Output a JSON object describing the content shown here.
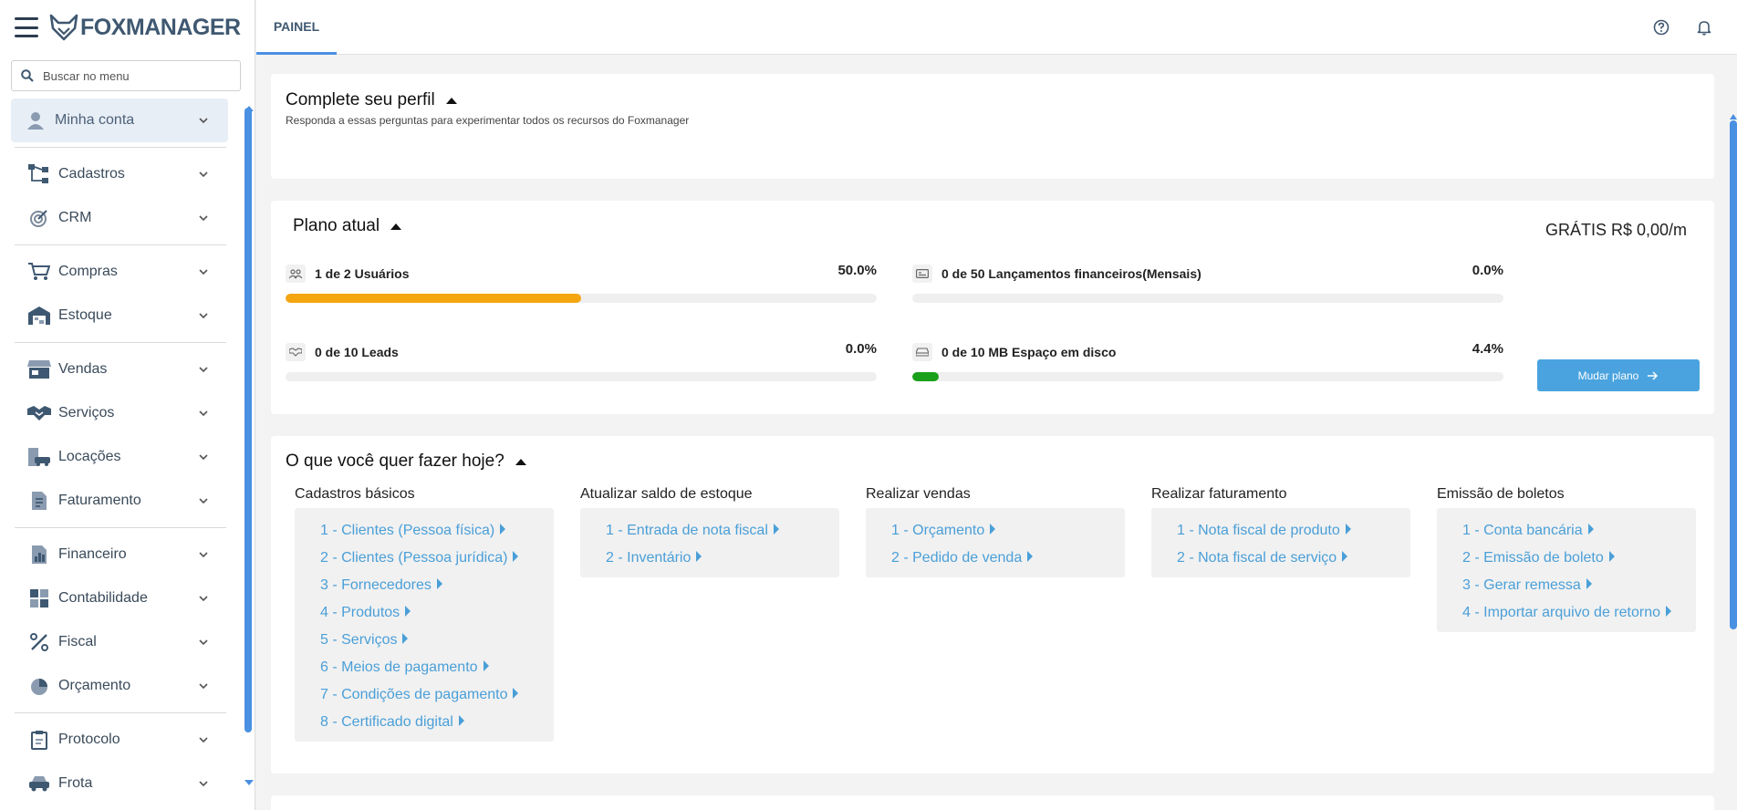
{
  "app": {
    "brand": "FOXMANAGER"
  },
  "search": {
    "placeholder": "Buscar no menu"
  },
  "sidebar": {
    "items": [
      {
        "label": "Minha conta",
        "icon": "user-icon"
      },
      {
        "label": "Cadastros",
        "icon": "sitemap-icon"
      },
      {
        "label": "CRM",
        "icon": "target-icon"
      },
      {
        "label": "Compras",
        "icon": "cart-icon"
      },
      {
        "label": "Estoque",
        "icon": "warehouse-icon"
      },
      {
        "label": "Vendas",
        "icon": "store-icon"
      },
      {
        "label": "Serviços",
        "icon": "handshake-icon"
      },
      {
        "label": "Locações",
        "icon": "building-car-icon"
      },
      {
        "label": "Faturamento",
        "icon": "invoice-icon"
      },
      {
        "label": "Financeiro",
        "icon": "chart-file-icon"
      },
      {
        "label": "Contabilidade",
        "icon": "calculator-icon"
      },
      {
        "label": "Fiscal",
        "icon": "percent-icon"
      },
      {
        "label": "Orçamento",
        "icon": "pie-chart-icon"
      },
      {
        "label": "Protocolo",
        "icon": "clipboard-icon"
      },
      {
        "label": "Frota",
        "icon": "car-icon"
      }
    ]
  },
  "header": {
    "tab": "PAINEL"
  },
  "profile": {
    "title": "Complete seu perfil",
    "subtitle": "Responda a essas perguntas para experimentar todos os recursos do Foxmanager"
  },
  "plan": {
    "title": "Plano atual",
    "price": "GRÁTIS R$ 0,00/m",
    "button": "Mudar plano",
    "usage": [
      {
        "label": "1 de 2 Usuários",
        "percent": "50.0%",
        "fill": 50.0,
        "color": "#f5a510",
        "icon": "users-icon"
      },
      {
        "label": "0 de 50 Lançamentos financeiros(Mensais)",
        "percent": "0.0%",
        "fill": 0.0,
        "color": "#f5a510",
        "icon": "money-icon"
      },
      {
        "label": "0 de 10 Leads",
        "percent": "0.0%",
        "fill": 0.0,
        "color": "#f5a510",
        "icon": "handshake-icon"
      },
      {
        "label": "0 de 10 MB Espaço em disco",
        "percent": "4.4%",
        "fill": 4.4,
        "color": "#1aa01a",
        "icon": "disk-icon"
      }
    ]
  },
  "todo": {
    "title": "O que você quer fazer hoje?",
    "columns": [
      {
        "title": "Cadastros básicos",
        "links": [
          "1 - Clientes (Pessoa física)",
          "2 - Clientes (Pessoa jurídica)",
          "3 - Fornecedores",
          "4 - Produtos",
          "5 - Serviços",
          "6 - Meios de pagamento",
          "7 - Condições de pagamento",
          "8 - Certificado digital"
        ]
      },
      {
        "title": "Atualizar saldo de estoque",
        "links": [
          "1 - Entrada de nota fiscal",
          "2 - Inventário"
        ]
      },
      {
        "title": "Realizar vendas",
        "links": [
          "1 - Orçamento",
          "2 - Pedido de venda"
        ]
      },
      {
        "title": "Realizar faturamento",
        "links": [
          "1 - Nota fiscal de produto",
          "2 - Nota fiscal de serviço"
        ]
      },
      {
        "title": "Emissão de boletos",
        "links": [
          "1 - Conta bancária",
          "2 - Emissão de boleto",
          "3 - Gerar remessa",
          "4 - Importar arquivo de retorno"
        ]
      }
    ]
  }
}
